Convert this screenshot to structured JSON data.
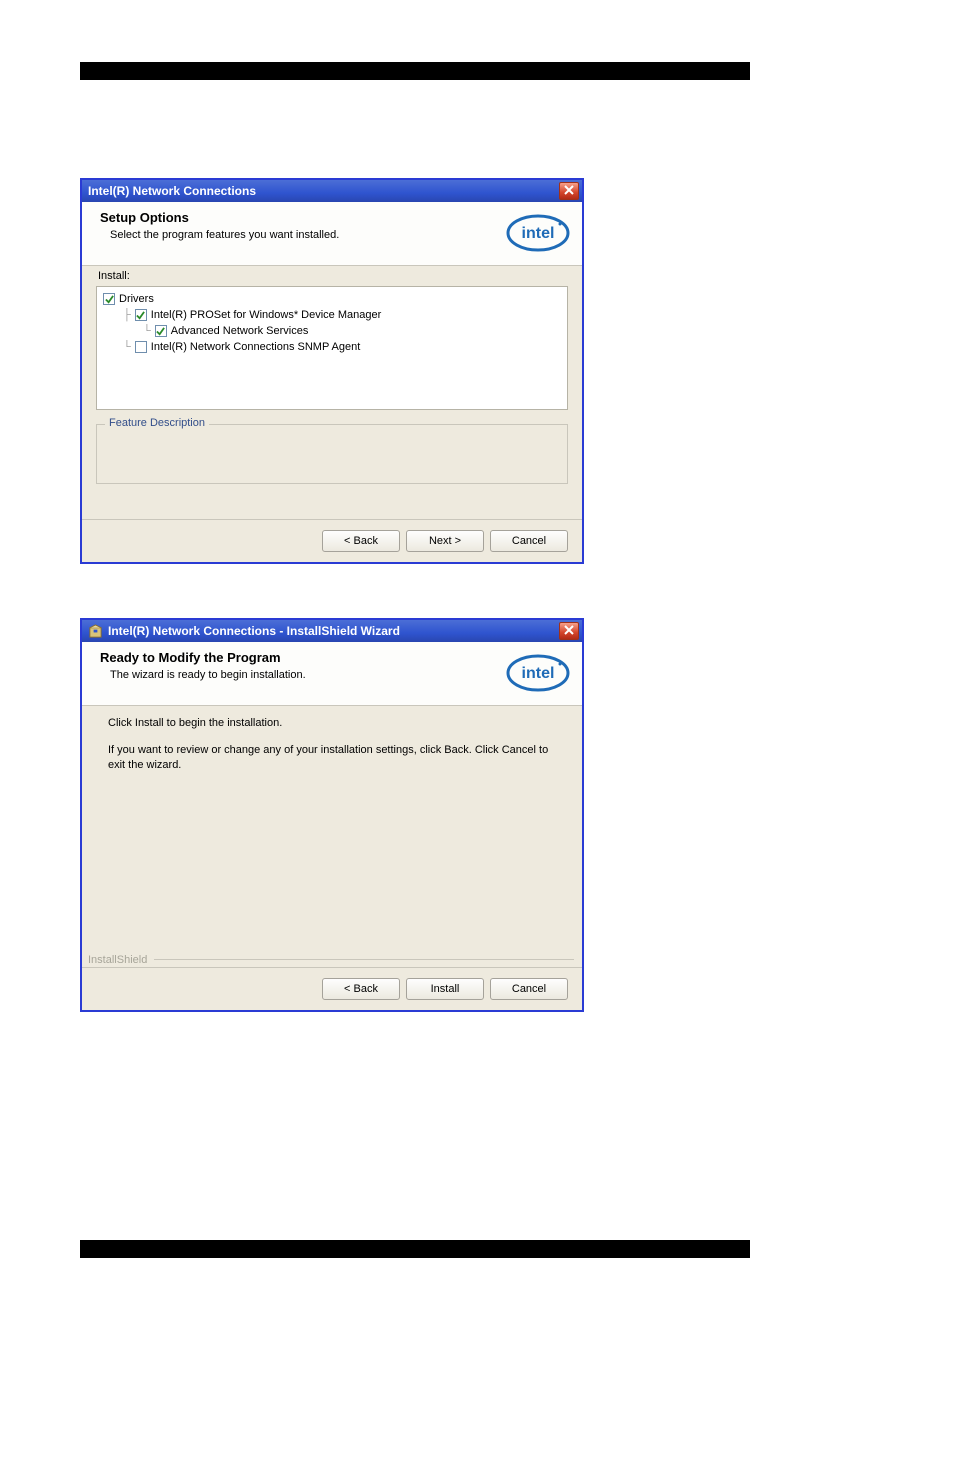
{
  "dialog1": {
    "title": "Intel(R) Network Connections",
    "header_title": "Setup Options",
    "header_sub": "Select the program features you want installed.",
    "install_label": "Install:",
    "tree": {
      "n0": {
        "label": "Drivers",
        "checked": true
      },
      "n1": {
        "label": "Intel(R) PROSet for Windows* Device Manager",
        "checked": true
      },
      "n2": {
        "label": "Advanced Network Services",
        "checked": true
      },
      "n3": {
        "label": "Intel(R) Network Connections SNMP Agent",
        "checked": false
      }
    },
    "group_legend": "Feature Description",
    "buttons": {
      "back": "< Back",
      "next": "Next >",
      "cancel": "Cancel"
    }
  },
  "dialog2": {
    "title": "Intel(R) Network Connections - InstallShield Wizard",
    "header_title": "Ready to Modify the Program",
    "header_sub": "The wizard is ready to begin installation.",
    "body_line1": "Click Install to begin the installation.",
    "body_line2": "If you want to review or change any of your installation settings, click Back. Click Cancel to exit the wizard.",
    "brand_label": "InstallShield",
    "buttons": {
      "back": "< Back",
      "install": "Install",
      "cancel": "Cancel"
    }
  },
  "icons": {
    "close": "close-icon",
    "app": "package-icon",
    "intel": "intel-logo"
  }
}
